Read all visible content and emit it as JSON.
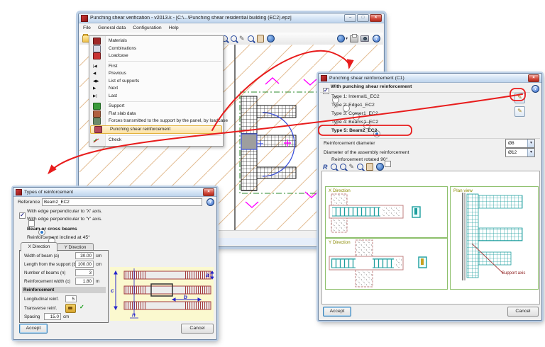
{
  "main_window": {
    "title": "Punching shear verification - v2013.k - [C:\\...\\Punching shear residential building (EC2).epz]",
    "menu_bar": {
      "file": "File",
      "general_data": "General data",
      "configuration": "Configuration",
      "help": "Help"
    },
    "menu": {
      "materials": "Materials",
      "combinations": "Combinations",
      "loadcase": "Loadcase",
      "first": "First",
      "previous": "Previous",
      "list_of_supports": "List of supports",
      "next": "Next",
      "last": "Last",
      "support": "Support",
      "flat_slab_data": "Flat slab data",
      "forces": "Forces transmitted to the support by the panel, by loadcase",
      "punching": "Punching shear reinforcement",
      "check": "Check"
    }
  },
  "reinf_dialog": {
    "title": "Punching shear reinforcement (C1)",
    "with_reinf": "With punching shear reinforcement",
    "type1": "Type 1: Internal1_EC2",
    "type2": "Type 2: Edge1_EC2",
    "type3": "Type 3: Corner1_EC2",
    "type4": "Type 4: Beams1_EC2",
    "type5": "Type 5: Beam2_EC2",
    "diameter_label": "Reinforcement diameter",
    "diameter_value": "Ø8",
    "assembly_label": "Diameter of the assembly reinforcement",
    "assembly_value": "Ø12",
    "rotated_label": "Reinforcement rotated 90°",
    "x_direction": "X Direction",
    "y_direction": "Y Direction",
    "plan_view": "Plan view",
    "support_axis": "Support axis",
    "accept": "Accept",
    "cancel": "Cancel"
  },
  "types_dialog": {
    "title": "Types of reinforcement",
    "reference_label": "Reference",
    "reference_value": "Beam2_EC2",
    "edge_x": "With edge perpendicular to 'X' axis.",
    "edge_y": "With edge perpendicular to 'Y' axis.",
    "beam_or_cross": "Beam or cross beams",
    "inclined_45": "Reinforcement inclined at 45°",
    "tab_x": "X Direction",
    "tab_y": "Y Direction",
    "width_label": "Width of beam (a)",
    "width_value": "30.00",
    "width_unit": "cm",
    "length_label": "Length from the support (b)",
    "length_value": "100.00",
    "length_unit": "cm",
    "num_beams_label": "Number of beams (n)",
    "num_beams_value": "3",
    "reinf_width_label": "Reinforcement width (c)",
    "reinf_width_value": "1.80",
    "reinf_width_unit": "m",
    "reinforcement_header": "Reinforcement",
    "longitudinal_label": "Longitudinal reinf.",
    "longitudinal_value": "5",
    "transverse_label": "Transverse reinf.",
    "spacing_label": "Spacing",
    "spacing_value": "15.0",
    "spacing_unit": "cm",
    "dim_a": "a",
    "dim_b": "b",
    "dim_c": "c",
    "dim_n": "n",
    "accept": "Accept",
    "cancel": "Cancel"
  }
}
